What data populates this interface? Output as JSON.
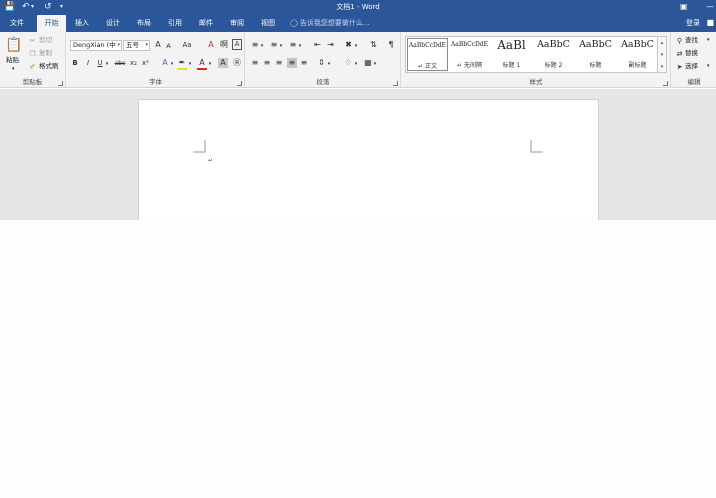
{
  "titlebar": {
    "title": "文档1 - Word",
    "save_icon": "save-icon",
    "undo_icon": "undo-icon",
    "redo_icon": "redo-icon",
    "customize_icon": "customize-icon"
  },
  "tabs": [
    {
      "label": "文件"
    },
    {
      "label": "开始"
    },
    {
      "label": "插入"
    },
    {
      "label": "设计"
    },
    {
      "label": "布局"
    },
    {
      "label": "引用"
    },
    {
      "label": "邮件"
    },
    {
      "label": "审阅"
    },
    {
      "label": "视图"
    }
  ],
  "tell_me": "告诉我您想要做什么...",
  "sign_in": "登录",
  "clipboard": {
    "paste": "粘贴",
    "cut": "剪切",
    "copy": "复制",
    "format_painter": "格式刷",
    "group_label": "剪贴板"
  },
  "font": {
    "font_name": "DengXian (中",
    "font_size": "五号",
    "group_label": "字体",
    "bold": "B",
    "italic": "I",
    "underline": "U",
    "strike": "abc",
    "subscript": "x₂",
    "superscript": "x²",
    "case": "Aa",
    "grow": "A",
    "shrink": "A"
  },
  "paragraph": {
    "group_label": "段落"
  },
  "styles": {
    "group_label": "样式",
    "items": [
      {
        "sample": "AaBbCcDdE",
        "name": "↵ 正文"
      },
      {
        "sample": "AaBbCcDdE",
        "name": "↵ 无间隔"
      },
      {
        "sample": "AaBl",
        "name": "标题 1"
      },
      {
        "sample": "AaBbC",
        "name": "标题 2"
      },
      {
        "sample": "AaBbC",
        "name": "标题"
      },
      {
        "sample": "AaBbC",
        "name": "副标题"
      }
    ]
  },
  "editing": {
    "find": "查找",
    "replace": "替换",
    "select": "选择",
    "group_label": "编辑"
  },
  "document": {
    "paragraph_mark": "↵"
  },
  "colors": {
    "accent": "#2b579a",
    "ribbon": "#f3f3f3",
    "canvas": "#e6e6e6"
  }
}
